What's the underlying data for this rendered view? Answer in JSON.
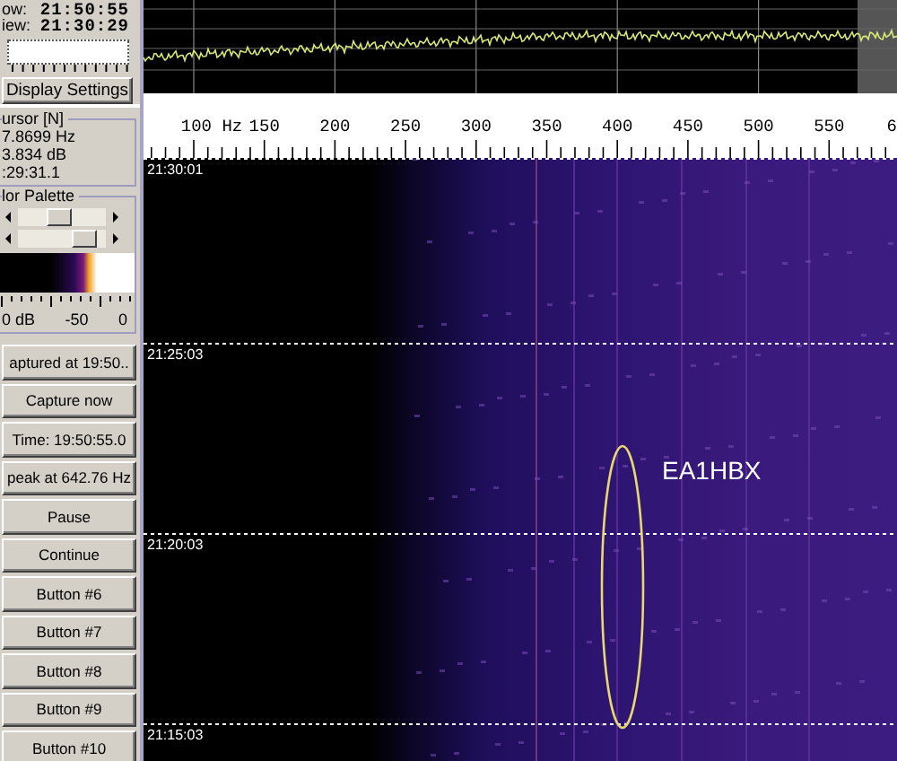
{
  "status": [
    {
      "label": "ow:",
      "value": "21:50:55"
    },
    {
      "label": "iew:",
      "value": "21:30:29"
    }
  ],
  "display_settings_button": "Display Settings",
  "cursor": {
    "title": "ursor [N]",
    "lines": [
      "7.8699 Hz",
      "3.834 dB",
      ":29:31.1"
    ]
  },
  "palette": {
    "title": "lor Palette",
    "sliders": [
      {
        "level": 0.45
      },
      {
        "level": 0.85
      }
    ],
    "scale_labels": [
      "0 dB",
      "-50",
      "0"
    ]
  },
  "buttons": [
    "aptured at 19:50..",
    "Capture now",
    "Time:  19:50:55.0",
    "peak at 642.76 Hz",
    "Pause",
    "Continue",
    "Button #6",
    "Button #7",
    "Button #8",
    "Button #9",
    "Button #10"
  ],
  "frequency_scale": {
    "labels": [
      "100 Hz",
      "150",
      "200",
      "250",
      "300",
      "350",
      "400",
      "450",
      "500",
      "550",
      "6"
    ]
  },
  "waterfall": {
    "time_labels": [
      "21:30:01",
      "21:25:03",
      "21:20:03",
      "21:15:03"
    ],
    "annotation": "EA1HBX"
  }
}
